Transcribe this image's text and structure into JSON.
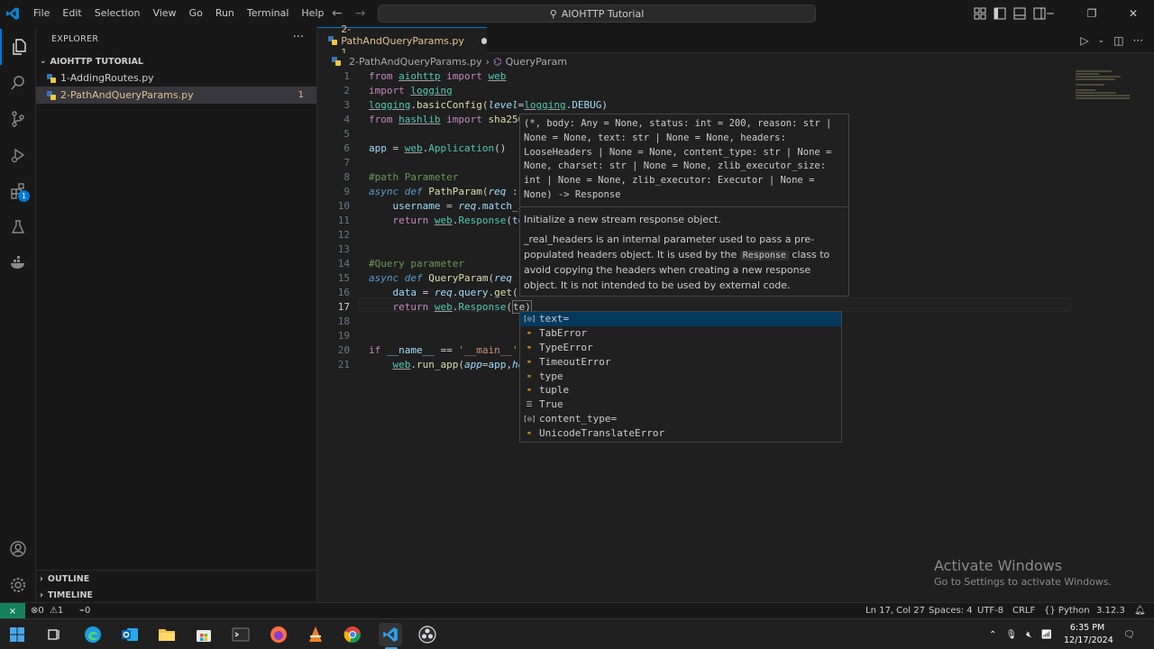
{
  "window": {
    "title": "AIOHTTP Tutorial"
  },
  "menu": [
    "File",
    "Edit",
    "Selection",
    "View",
    "Go",
    "Run",
    "Terminal",
    "Help"
  ],
  "sidebar": {
    "title": "EXPLORER",
    "folder": "AIOHTTP TUTORIAL",
    "files": [
      {
        "name": "1-AddingRoutes.py",
        "badge": ""
      },
      {
        "name": "2-PathAndQueryParams.py",
        "badge": "1"
      }
    ],
    "outline": "OUTLINE",
    "timeline": "TIMELINE"
  },
  "tab": {
    "label": "2-PathAndQueryParams.py 1"
  },
  "breadcrumbs": {
    "file": "2-PathAndQueryParams.py",
    "symbol": "QueryParam"
  },
  "line_numbers": [
    "1",
    "2",
    "3",
    "4",
    "5",
    "6",
    "7",
    "8",
    "9",
    "10",
    "11",
    "12",
    "13",
    "14",
    "15",
    "16",
    "17",
    "18",
    "19",
    "20",
    "21"
  ],
  "current_line": 17,
  "hover": {
    "signature": "(*, body: Any = None, status: int = 200, reason: str | None = None, text: str | None = None, headers: LooseHeaders | None = None, content_type: str | None = None, charset: str | None = None, zlib_executor_size: int | None = None, zlib_executor: Executor | None = None) -> Response",
    "doc1": "Initialize a new stream response object.",
    "doc2_a": "_real_headers is an internal parameter used to pass a pre-populated headers object. It is used by the",
    "doc2_code": "Response",
    "doc2_b": "class to avoid copying the headers when creating a new response object. It is not intended to be used by external code."
  },
  "suggestions": [
    {
      "label": "text=",
      "kind": "variable"
    },
    {
      "label": "TabError",
      "kind": "class"
    },
    {
      "label": "TypeError",
      "kind": "class"
    },
    {
      "label": "TimeoutError",
      "kind": "class"
    },
    {
      "label": "type",
      "kind": "class"
    },
    {
      "label": "tuple",
      "kind": "class"
    },
    {
      "label": "True",
      "kind": "keyword"
    },
    {
      "label": "content_type=",
      "kind": "variable"
    },
    {
      "label": "UnicodeTranslateError",
      "kind": "class"
    }
  ],
  "watermark": {
    "line1": "Activate Windows",
    "line2": "Go to Settings to activate Windows."
  },
  "status": {
    "errors": "0",
    "warnings": "1",
    "ports": "0",
    "position": "Ln 17, Col 27",
    "spaces": "Spaces: 4",
    "encoding": "UTF-8",
    "eol": "CRLF",
    "language": "Python",
    "version": "3.12.3"
  },
  "taskbar": {
    "time": "6:35 PM",
    "date": "12/17/2024"
  },
  "colors": {
    "accent": "#0078d4",
    "remote": "#16825d",
    "modified": "#e2c08d"
  }
}
